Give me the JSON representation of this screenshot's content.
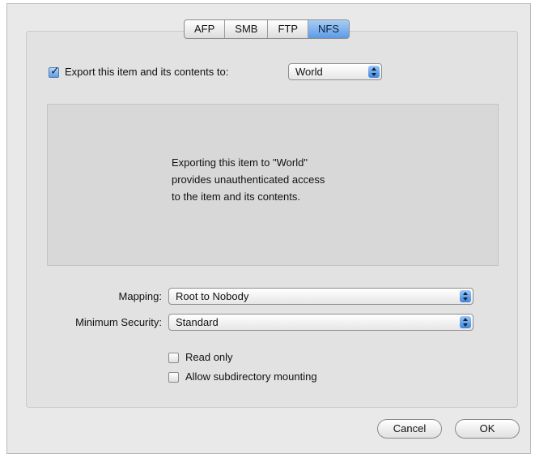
{
  "tabs": [
    {
      "label": "AFP",
      "active": false
    },
    {
      "label": "SMB",
      "active": false
    },
    {
      "label": "FTP",
      "active": false
    },
    {
      "label": "NFS",
      "active": true
    }
  ],
  "export": {
    "checked": true,
    "label": "Export this item and its contents to:",
    "target": "World"
  },
  "info": {
    "lines": [
      "Exporting this item to \"World\"",
      "provides unauthenticated access",
      "to the item and its contents."
    ]
  },
  "mapping": {
    "label": "Mapping:",
    "value": "Root to Nobody"
  },
  "security": {
    "label": "Minimum Security:",
    "value": "Standard"
  },
  "options": [
    {
      "label": "Read only",
      "checked": false
    },
    {
      "label": "Allow subdirectory mounting",
      "checked": false
    }
  ],
  "buttons": {
    "cancel": "Cancel",
    "ok": "OK"
  },
  "colors": {
    "accent": "#5b9be6",
    "panel": "#e2e2e2"
  }
}
